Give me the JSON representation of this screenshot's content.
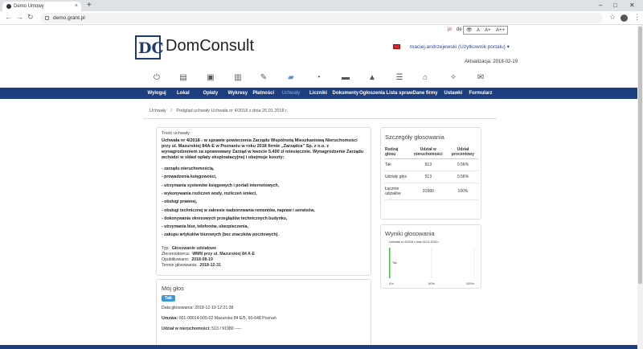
{
  "browser": {
    "tab_title": "Demo Umowy",
    "tab_close": "×",
    "new_tab": "+",
    "url": "demo.grant.pl",
    "back": "←",
    "forward": "→",
    "reload": "↻",
    "star": "☆",
    "menu": "⋮",
    "win_min": "–",
    "win_max": "□",
    "win_close": "✕"
  },
  "header": {
    "logo_letters": "DC",
    "brand": "DomConsult",
    "lang_pl": "pl",
    "lang_de": "de",
    "access_eye": "👁",
    "access_a1": "A",
    "access_a2": "A+",
    "access_a3": "A++",
    "user": "maciej.andrzejewski (Użytkownik portalu) ▾",
    "update": "Aktualizacja: 2018-02-19"
  },
  "menu": [
    {
      "label": "Wyloguj",
      "icon": "power-icon"
    },
    {
      "label": "Lokal",
      "icon": "building-icon"
    },
    {
      "label": "Opłaty",
      "icon": "money-icon"
    },
    {
      "label": "Wykresy",
      "icon": "chart-icon"
    },
    {
      "label": "Płatności",
      "icon": "edit-icon"
    },
    {
      "label": "Uchwały",
      "icon": "book-icon"
    },
    {
      "label": "Liczniki",
      "icon": "gauge-icon"
    },
    {
      "label": "Dokumenty",
      "icon": "archive-icon"
    },
    {
      "label": "Ogłoszenia",
      "icon": "warning-icon"
    },
    {
      "label": "Lista spraw",
      "icon": "list-icon"
    },
    {
      "label": "Dane firmy",
      "icon": "bank-icon"
    },
    {
      "label": "Ustawki",
      "icon": "wrench-icon"
    },
    {
      "label": "Formularz",
      "icon": "envelope-icon"
    }
  ],
  "breadcrumb": {
    "root": "Uchwały",
    "sep": "/",
    "current": "Podgląd uchwały Uchwała nr 4/2018 z dnia 26.01.2018 r."
  },
  "resolution": {
    "label": "Treść uchwały",
    "body": "Uchwała nr 4/2018 - w sprawie powierzenia Zarządu Wspólnotą Mieszkaniową Nieruchomości przy ul. Mazurskiej 84A-E w Poznaniu w roku 2018 firmie „Zarządca” Sp. z o.o. z wynagrodzeniem za sprawowany Zarząd w kwocie 5.400 zł miesięcznie. Wynagrodzenie Zarządu wchodzi w skład opłaty eksploatacyjnej i obejmuje koszty:",
    "items": [
      "- zarządu nieruchomością,",
      "- prowadzenia księgowości,",
      "- utrzymania systemów księgowych i portali internetowych,",
      "- wykonywania rozliczeń wody, rozliczeń śmieci,",
      "- obsługi prawnej,",
      "- obsługi technicznej w zakresie nadzorowania remontów, napraw i serwisów,",
      "- dokonywania okresowych przeglądów technicznych budynku,",
      "- utrzymania biur, telefonów, ubezpieczenia,",
      "- zakupu artykułów biurowych (bez znaczków pocztowych)."
    ],
    "meta": [
      {
        "k": "Typ:",
        "v": "Głosowanie udziałowe"
      },
      {
        "k": "Zleceniobiorca:",
        "v": "WMN przy ul. Mazurskiej 84 A-E"
      },
      {
        "k": "Opublikowano:",
        "v": "2018-08-19"
      },
      {
        "k": "Termin głosowania:",
        "v": "2018-12-31"
      }
    ]
  },
  "my_vote": {
    "title": "Mój głos",
    "badge": "Tak",
    "date_label": "Data głosowania:",
    "date": "2018-12-19 12:21:38",
    "contract_label": "Umowa:",
    "contract": "001-00014-505-02 Mazurska 84 E/5, 60-648 Poznań",
    "share_label": "Udział w nieruchomości:",
    "share": "513 / 91980 -----"
  },
  "details": {
    "title": "Szczegóły głosowania",
    "headers": [
      "Rodzaj głosu",
      "Udział w nieruchomości",
      "Udział procentowy"
    ],
    "rows": [
      [
        "Tak",
        "513",
        "0.56%"
      ],
      [
        "Udziały głos",
        "513",
        "0.56%"
      ],
      [
        "Łącznie udziałów",
        "91980",
        "100%"
      ]
    ]
  },
  "results": {
    "title": "Wyniki głosowania"
  },
  "chart_data": {
    "type": "bar",
    "title": "Uchwała nr 4/2018 z dnia 26.01.2018 r.",
    "categories": [
      "Tak"
    ],
    "values": [
      0.56
    ],
    "xlim": [
      0,
      100
    ],
    "xticks": [
      "0%",
      "50%",
      "100%"
    ],
    "bar_color": "#5cb85c",
    "orientation": "horizontal"
  }
}
